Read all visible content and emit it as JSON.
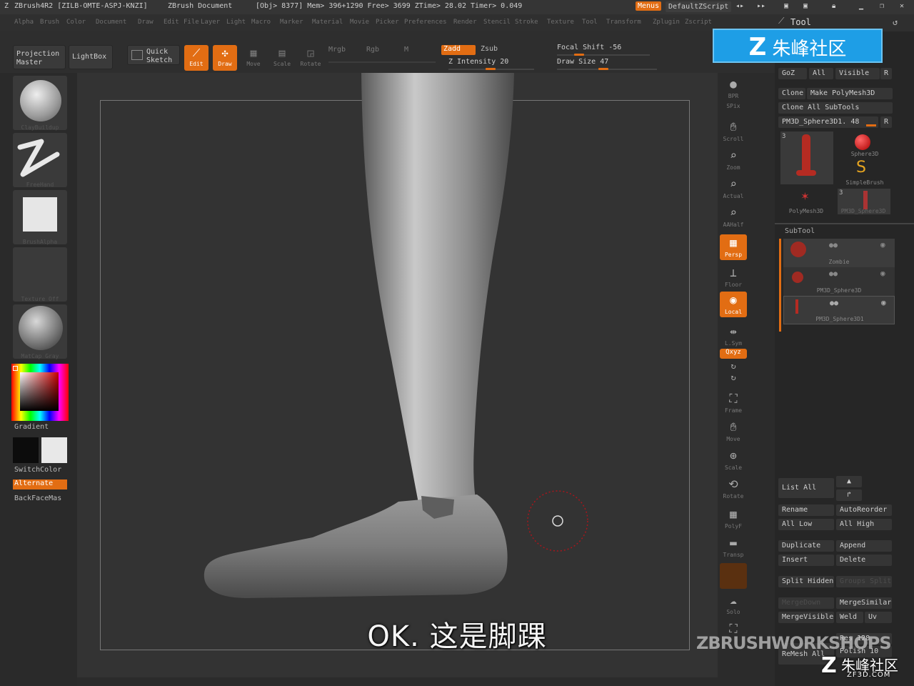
{
  "titlebar": {
    "app": "ZBrush4R2 [ZILB-OMTE-ASPJ-KNZI]",
    "document": "ZBrush Document",
    "stats": "[Obj> 8377] Mem> 396+1290 Free> 3699 ZTime> 28.02 Timer> 0.049",
    "menus_label": "Menus",
    "script_label": "DefaultZScript"
  },
  "menubar": [
    "Alpha",
    "Brush",
    "Color",
    "Document",
    "Draw",
    "Edit",
    "File",
    "Layer",
    "Light",
    "Macro",
    "Marker",
    "Material",
    "Movie",
    "Picker",
    "Preferences",
    "Render",
    "Stencil",
    "Stroke",
    "Texture",
    "Tool",
    "Transform",
    "Zplugin",
    "Zscript"
  ],
  "toolbar": {
    "projection_master": "Projection Master",
    "lightbox": "LightBox",
    "quick_sketch": "Quick Sketch",
    "edit": "Edit",
    "draw": "Draw",
    "move": "Move",
    "scale": "Scale",
    "rotate": "Rotate",
    "mrgb": "Mrgb",
    "rgb": "Rgb",
    "m": "M",
    "zadd": "Zadd",
    "zsub": "Zsub",
    "z_intensity": "Z Intensity 20",
    "focal_shift": "Focal Shift -56",
    "draw_size": "Draw Size 47"
  },
  "leftshelf": {
    "brush_label": "ClayBuildup",
    "stroke_label": "FreeHand",
    "alpha_label": "BrushAlpha",
    "texture_label": "Texture Off",
    "material_label": "MatCap Gray",
    "gradient": "Gradient",
    "switchcolor": "SwitchColor",
    "alternate": "Alternate",
    "backfacemask": "BackFaceMas"
  },
  "rightshelf": [
    "BPR",
    "SPix",
    "Scroll",
    "Zoom",
    "Actual",
    "AAHalf",
    "Persp",
    "Floor",
    "Local",
    "L.Sym",
    "Qxyz",
    "Frame",
    "Move",
    "Scale",
    "Rotate",
    "PolyF",
    "Transp",
    "Solo",
    "Xpose"
  ],
  "toolpanel": {
    "title": "Tool",
    "goz": "GoZ",
    "all": "All",
    "visible": "Visible",
    "r": "R",
    "clone": "Clone",
    "make_polymesh": "Make PolyMesh3D",
    "clone_all": "Clone All SubTools",
    "current_tool": "PM3D_Sphere3D1. 48",
    "thumb_count": "3",
    "sphere3d": "Sphere3D",
    "simplebrush": "SimpleBrush",
    "polymesh3d": "PolyMesh3D",
    "pm3d_sphere": "PM3D_Sphere3D",
    "subtool": "SubTool",
    "subtools": [
      "Zombie",
      "PM3D_Sphere3D",
      "PM3D_Sphere3D1"
    ],
    "list_all": "List All",
    "rename": "Rename",
    "autoreorder": "AutoReorder",
    "all_low": "All Low",
    "all_high": "All High",
    "duplicate": "Duplicate",
    "append": "Append",
    "insert": "Insert",
    "delete": "Delete",
    "split_hidden": "Split Hidden",
    "groups_split": "Groups Split",
    "merge_down": "MergeDown",
    "merge_similar": "MergeSimilar",
    "merge_visible": "MergeVisible",
    "weld": "Weld",
    "uv": "Uv",
    "remesh_all": "ReMesh All",
    "res": "Res 128",
    "polish": "Polish 10"
  },
  "subtitle": "OK. 这是脚踝",
  "watermarks": {
    "top": "朱峰社区",
    "zbrush_workshops": "ZBRUSHWORKSHOPS",
    "bottom": "朱峰社区",
    "bottom_url": "ZF3D.COM"
  },
  "colors": {
    "accent": "#e26d13",
    "canvas": "#333333",
    "panel": "#262626"
  }
}
